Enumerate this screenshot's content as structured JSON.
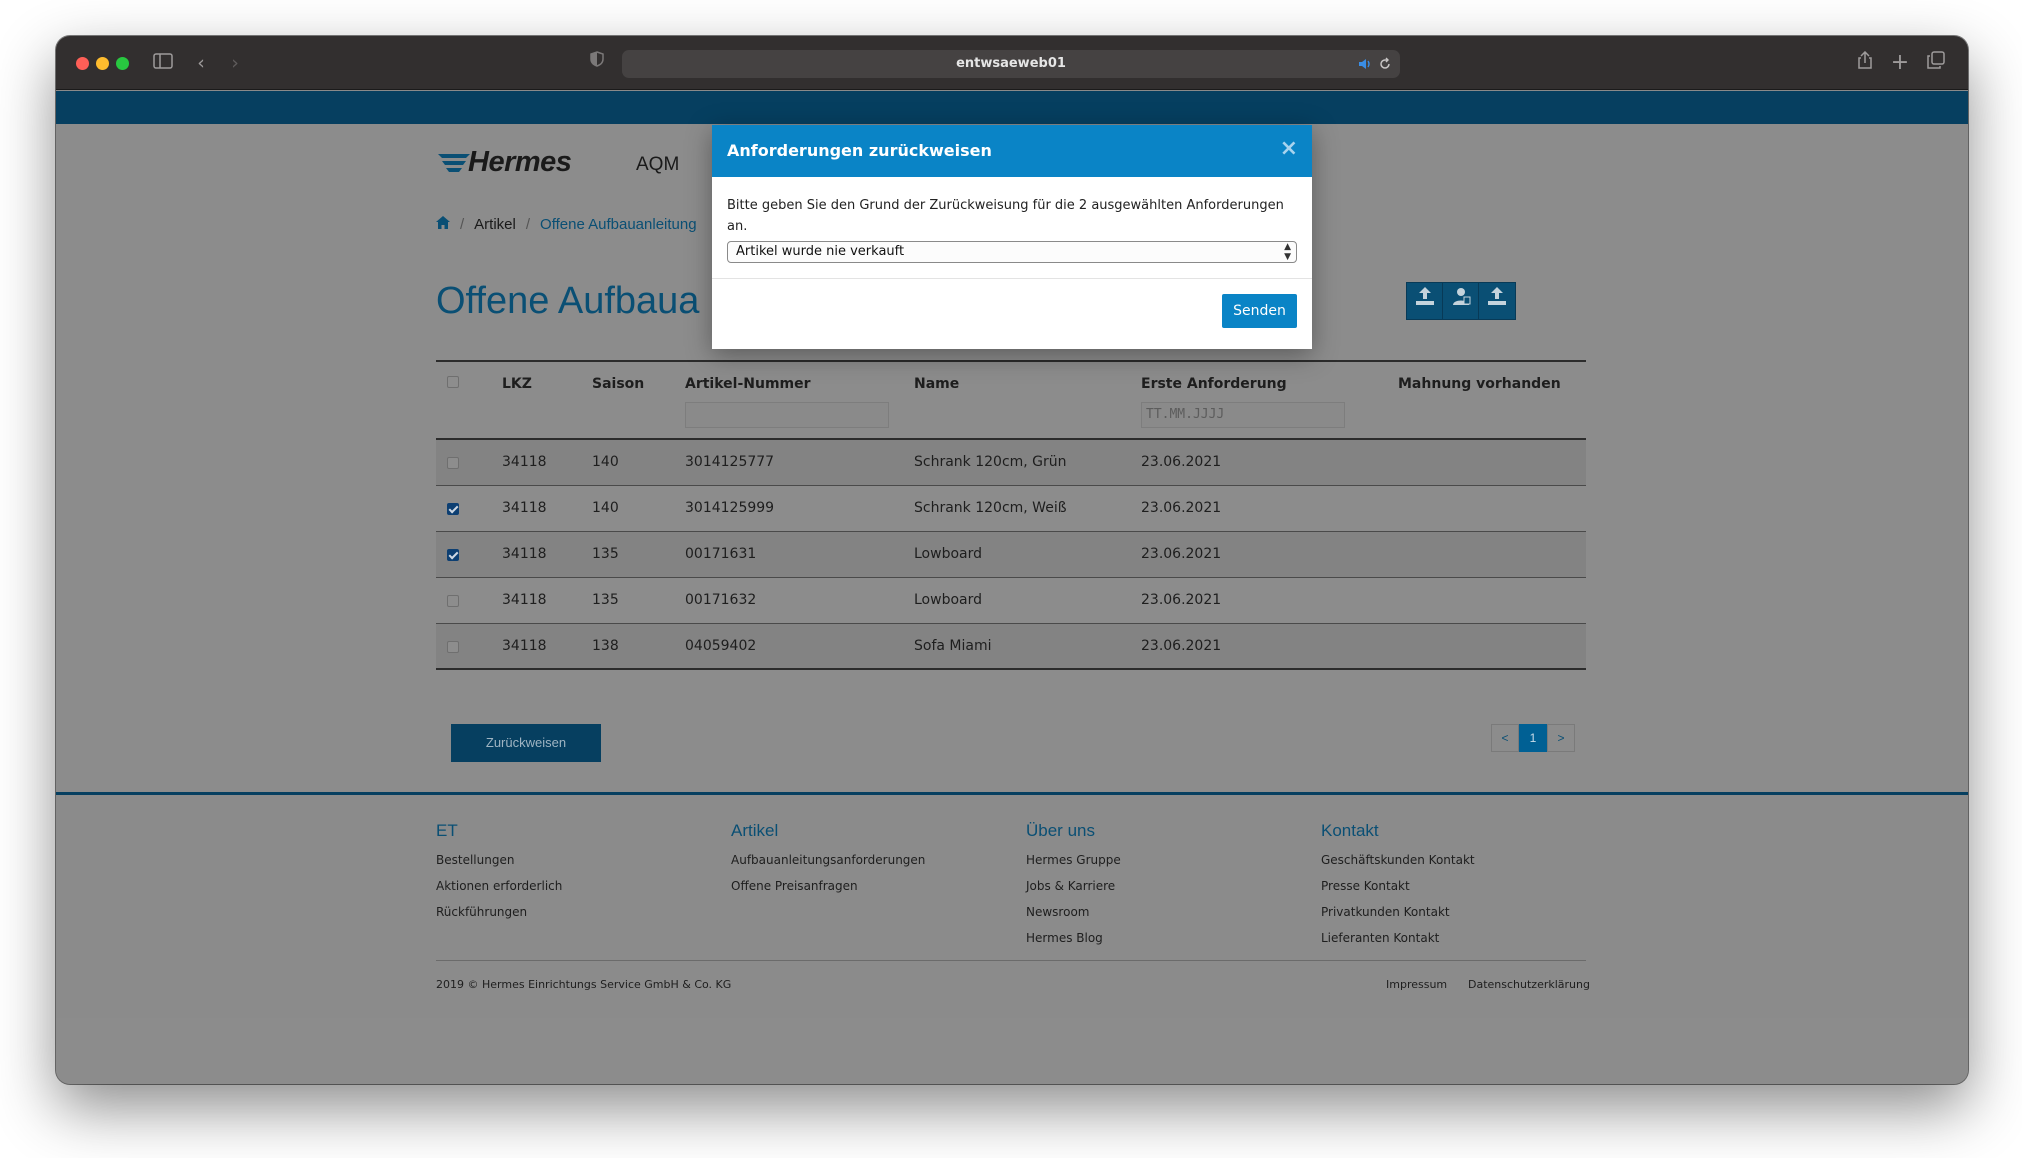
{
  "browser": {
    "url": "entwsaeweb01"
  },
  "header": {
    "logo": "Hermes",
    "nav": "AQM"
  },
  "breadcrumb": {
    "items": [
      "Artikel",
      "Offene Aufbauanleitung"
    ]
  },
  "page": {
    "title": "Offene Aufbaua"
  },
  "table": {
    "headers": {
      "lkz": "LKZ",
      "saison": "Saison",
      "artikel": "Artikel-Nummer",
      "name": "Name",
      "erste": "Erste Anforderung",
      "mahnung": "Mahnung vorhanden"
    },
    "filter_date_placeholder": "TT.MM.JJJJ",
    "rows": [
      {
        "checked": false,
        "lkz": "34118",
        "saison": "140",
        "artikel": "3014125777",
        "name": "Schrank 120cm, Grün",
        "datum": "23.06.2021",
        "mahnung": ""
      },
      {
        "checked": true,
        "lkz": "34118",
        "saison": "140",
        "artikel": "3014125999",
        "name": "Schrank 120cm, Weiß",
        "datum": "23.06.2021",
        "mahnung": ""
      },
      {
        "checked": true,
        "lkz": "34118",
        "saison": "135",
        "artikel": "00171631",
        "name": "Lowboard",
        "datum": "23.06.2021",
        "mahnung": ""
      },
      {
        "checked": false,
        "lkz": "34118",
        "saison": "135",
        "artikel": "00171632",
        "name": "Lowboard",
        "datum": "23.06.2021",
        "mahnung": ""
      },
      {
        "checked": false,
        "lkz": "34118",
        "saison": "138",
        "artikel": "04059402",
        "name": "Sofa Miami",
        "datum": "23.06.2021",
        "mahnung": ""
      }
    ]
  },
  "actions": {
    "reject_label": "Zurückweisen"
  },
  "pagination": {
    "prev": "<",
    "current": "1",
    "next": ">"
  },
  "footer": {
    "cols": [
      {
        "title": "ET",
        "links": [
          "Bestellungen",
          "Aktionen erforderlich",
          "Rückführungen"
        ]
      },
      {
        "title": "Artikel",
        "links": [
          "Aufbauanleitungsanforderungen",
          "Offene Preisanfragen"
        ]
      },
      {
        "title": "Über uns",
        "links": [
          "Hermes Gruppe",
          "Jobs & Karriere",
          "Newsroom",
          "Hermes Blog"
        ]
      },
      {
        "title": "Kontakt",
        "links": [
          "Geschäftskunden Kontakt",
          "Presse Kontakt",
          "Privatkunden Kontakt",
          "Lieferanten Kontakt"
        ]
      }
    ],
    "copyright": "2019 © Hermes Einrichtungs Service GmbH & Co. KG",
    "impressum": "Impressum",
    "datenschutz": "Datenschutzerklärung"
  },
  "modal": {
    "title": "Anforderungen zurückweisen",
    "close": "×",
    "text": "Bitte geben Sie den Grund der Zurückweisung für die 2 ausgewählten Anforderungen an.",
    "select_value": "Artikel wurde nie verkauft",
    "send_label": "Senden"
  },
  "colors": {
    "brand_blue": "#0a84c6",
    "dark_blue": "#063f60",
    "overlay_gray": "#8c8c8c"
  }
}
